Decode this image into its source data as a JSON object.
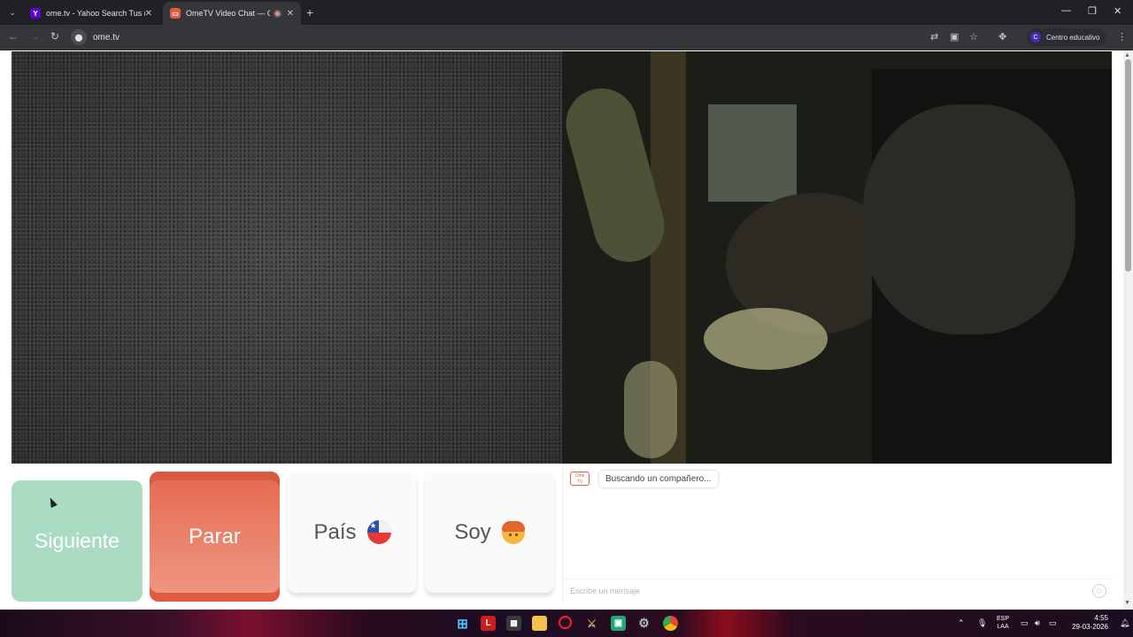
{
  "browser": {
    "tabs": [
      {
        "title": "ome.tv - Yahoo Search Tus resu",
        "favicon": "yahoo-icon",
        "favicon_letter": "Y",
        "favicon_color": "#5f01d1",
        "active": false
      },
      {
        "title": "OmeTV Video Chat — Ome",
        "favicon": "ometv-icon",
        "favicon_color": "#e05a40",
        "active": true
      }
    ],
    "url": "ome.tv",
    "profile_initial": "C",
    "profile_name": "Centro educativo"
  },
  "page": {
    "buttons": {
      "next": "Siguiente",
      "stop": "Parar",
      "country": "País",
      "country_flag": "flag-chile-icon",
      "gender": "Soy",
      "gender_icon": "boy-emoji-icon"
    },
    "chat": {
      "logo_text_top": "Ome",
      "logo_text_bottom": "TV",
      "status_message": "Buscando un compañero...",
      "input_placeholder": "Escribe un mensaje"
    },
    "colors": {
      "next_button": "#a9dcc3",
      "stop_button": "#e5694f",
      "accent": "#e05a40"
    }
  },
  "taskbar": {
    "apps": [
      "windows-start-icon",
      "l-app-icon",
      "store-icon",
      "file-explorer-icon",
      "opera-icon",
      "league-icon",
      "green-app-icon",
      "settings-icon",
      "chrome-icon"
    ],
    "tray": {
      "lang_top": "ESP",
      "lang_bottom": "LAA",
      "time": "4:55",
      "date": "29-03-2026"
    }
  }
}
